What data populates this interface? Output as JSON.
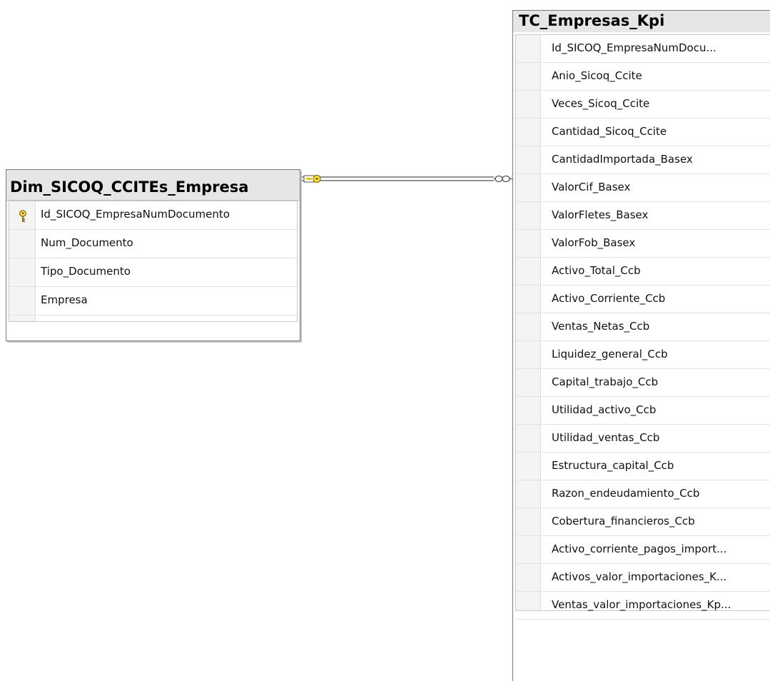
{
  "tables": [
    {
      "title": "Dim_SICOQ_CCITEs_Empresa",
      "columns": [
        {
          "name": "Id_SICOQ_EmpresaNumDocumento",
          "primary_key": true
        },
        {
          "name": "Num_Documento",
          "primary_key": false
        },
        {
          "name": "Tipo_Documento",
          "primary_key": false
        },
        {
          "name": "Empresa",
          "primary_key": false
        }
      ]
    },
    {
      "title": "TC_Empresas_Kpi",
      "columns": [
        {
          "name": "Id_SICOQ_EmpresaNumDocu..."
        },
        {
          "name": "Anio_Sicoq_Ccite"
        },
        {
          "name": "Veces_Sicoq_Ccite"
        },
        {
          "name": "Cantidad_Sicoq_Ccite"
        },
        {
          "name": "CantidadImportada_Basex"
        },
        {
          "name": "ValorCif_Basex"
        },
        {
          "name": "ValorFletes_Basex"
        },
        {
          "name": "ValorFob_Basex"
        },
        {
          "name": "Activo_Total_Ccb"
        },
        {
          "name": "Activo_Corriente_Ccb"
        },
        {
          "name": "Ventas_Netas_Ccb"
        },
        {
          "name": "Liquidez_general_Ccb"
        },
        {
          "name": "Capital_trabajo_Ccb"
        },
        {
          "name": "Utilidad_activo_Ccb"
        },
        {
          "name": "Utilidad_ventas_Ccb"
        },
        {
          "name": "Estructura_capital_Ccb"
        },
        {
          "name": "Razon_endeudamiento_Ccb"
        },
        {
          "name": "Cobertura_financieros_Ccb"
        },
        {
          "name": "Activo_corriente_pagos_import..."
        },
        {
          "name": "Activos_valor_importaciones_K..."
        },
        {
          "name": "Ventas_valor_importaciones_Kp..."
        }
      ]
    }
  ],
  "relationship": {
    "from_end": "key-icon",
    "to_end": "infinity-icon",
    "colors": {
      "line": "#505050",
      "key": "#e8c400"
    }
  }
}
